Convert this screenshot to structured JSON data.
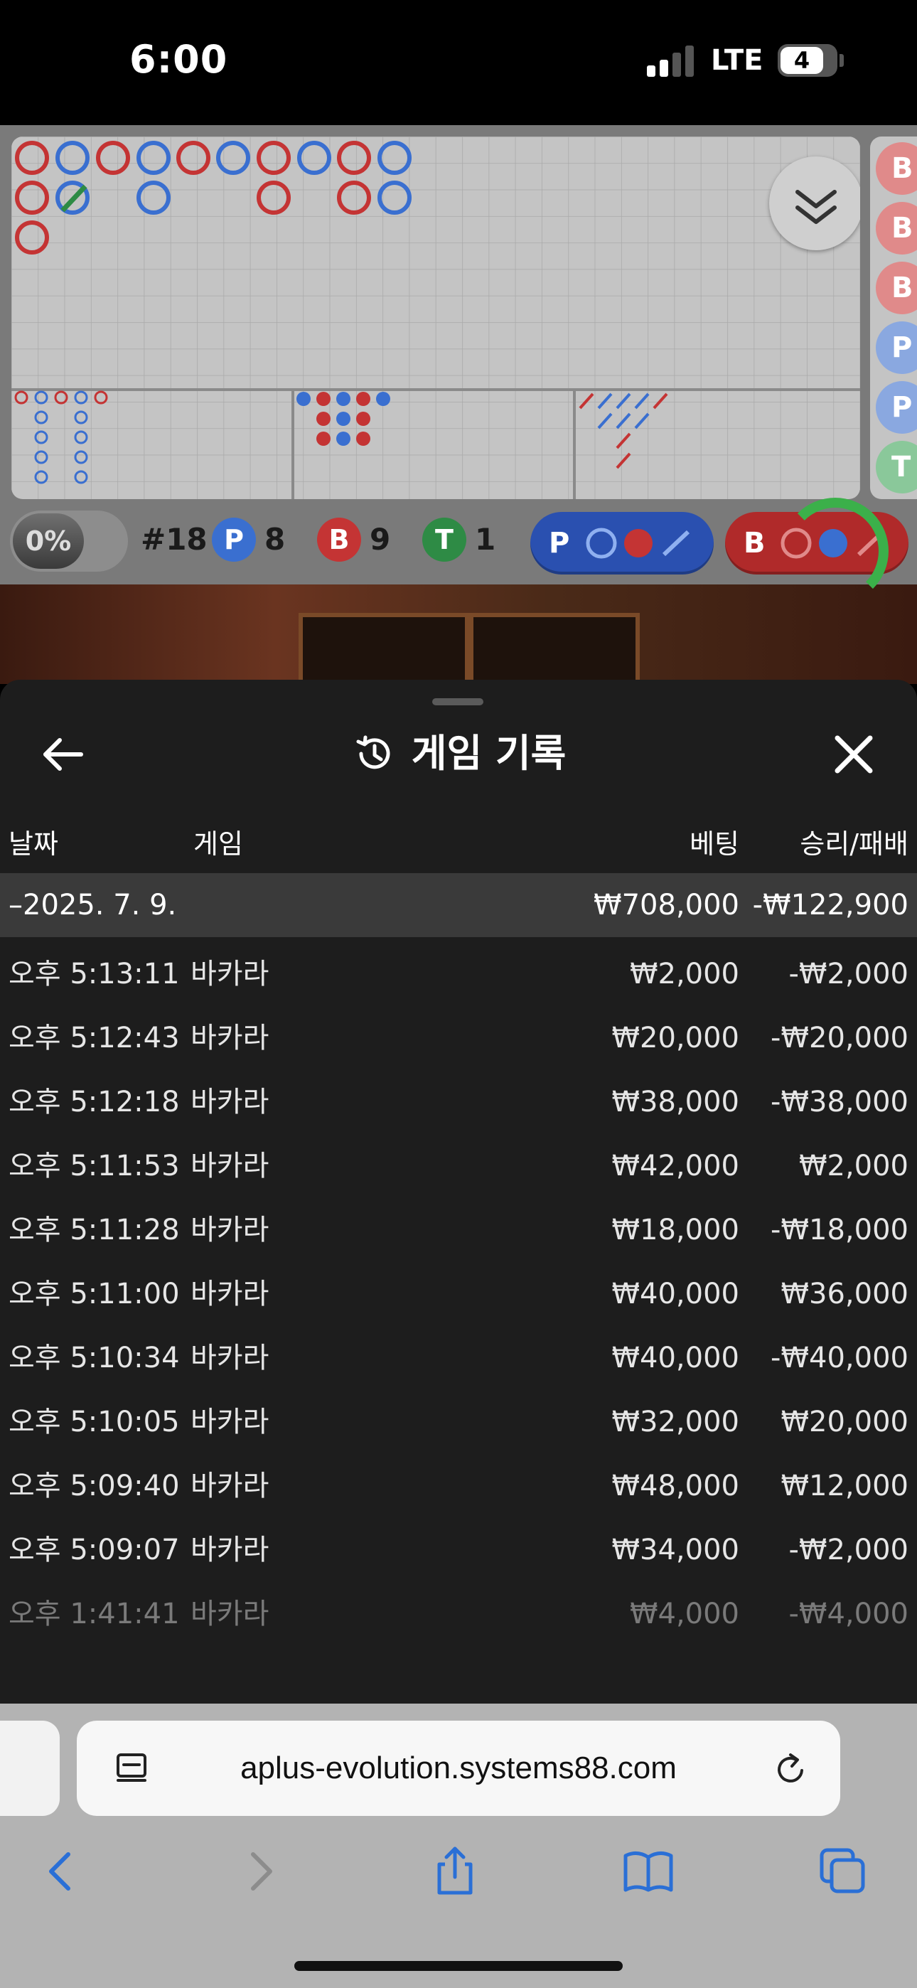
{
  "status": {
    "time": "6:00",
    "network": "LTE",
    "battery": "4"
  },
  "stats": {
    "percent": "0%",
    "round": "#18",
    "player_label": "P",
    "player_count": "8",
    "banker_label": "B",
    "banker_count": "9",
    "tie_label": "T",
    "tie_count": "1",
    "player_predict_label": "P",
    "banker_predict_label": "B"
  },
  "side_peek": [
    "B",
    "B",
    "B",
    "P",
    "P",
    "T"
  ],
  "colors": {
    "player": "#3a6fd0",
    "banker": "#c43434",
    "tie": "#2e8b45",
    "sheet_bg": "#1d1d1d"
  },
  "history": {
    "title": "게임 기록",
    "columns": {
      "date": "날짜",
      "game": "게임",
      "bet": "베팅",
      "result": "승리/패배"
    },
    "date_row": {
      "date": "–2025. 7. 9.",
      "bet": "₩708,000",
      "result": "-₩122,900"
    },
    "rows": [
      {
        "time": "오후 5:13:11",
        "game": "바카라",
        "bet": "₩2,000",
        "result": "-₩2,000"
      },
      {
        "time": "오후 5:12:43",
        "game": "바카라",
        "bet": "₩20,000",
        "result": "-₩20,000"
      },
      {
        "time": "오후 5:12:18",
        "game": "바카라",
        "bet": "₩38,000",
        "result": "-₩38,000"
      },
      {
        "time": "오후 5:11:53",
        "game": "바카라",
        "bet": "₩42,000",
        "result": "₩2,000"
      },
      {
        "time": "오후 5:11:28",
        "game": "바카라",
        "bet": "₩18,000",
        "result": "-₩18,000"
      },
      {
        "time": "오후 5:11:00",
        "game": "바카라",
        "bet": "₩40,000",
        "result": "₩36,000"
      },
      {
        "time": "오후 5:10:34",
        "game": "바카라",
        "bet": "₩40,000",
        "result": "-₩40,000"
      },
      {
        "time": "오후 5:10:05",
        "game": "바카라",
        "bet": "₩32,000",
        "result": "₩20,000"
      },
      {
        "time": "오후 5:09:40",
        "game": "바카라",
        "bet": "₩48,000",
        "result": "₩12,000"
      },
      {
        "time": "오후 5:09:07",
        "game": "바카라",
        "bet": "₩34,000",
        "result": "-₩2,000"
      },
      {
        "time": "오후 1:41:41",
        "game": "바카라",
        "bet": "₩4,000",
        "result": "-₩4,000"
      }
    ]
  },
  "browser": {
    "url": "aplus-evolution.systems88.com"
  }
}
